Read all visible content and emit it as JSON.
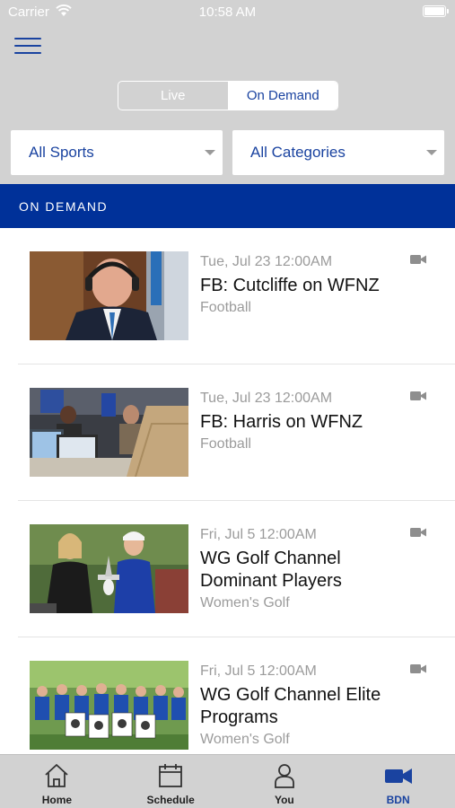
{
  "status_bar": {
    "carrier": "Carrier",
    "time": "10:58 AM"
  },
  "segmented": {
    "live_label": "Live",
    "ondemand_label": "On Demand",
    "selected": "On Demand"
  },
  "filters": {
    "sports": "All Sports",
    "categories": "All Categories"
  },
  "section": {
    "title": "ON DEMAND"
  },
  "videos": [
    {
      "date": "Tue, Jul 23 12:00AM",
      "title": "FB: Cutcliffe on WFNZ",
      "category": "Football"
    },
    {
      "date": "Tue, Jul 23 12:00AM",
      "title": "FB: Harris on WFNZ",
      "category": "Football"
    },
    {
      "date": "Fri, Jul 5 12:00AM",
      "title": "WG Golf Channel Dominant Players",
      "category": "Women's Golf"
    },
    {
      "date": "Fri, Jul 5 12:00AM",
      "title": "WG Golf Channel Elite Programs",
      "category": "Women's Golf"
    }
  ],
  "tabbar": {
    "items": [
      {
        "label": "Home",
        "icon": "house-icon"
      },
      {
        "label": "Schedule",
        "icon": "calendar-icon"
      },
      {
        "label": "You",
        "icon": "person-icon"
      },
      {
        "label": "BDN",
        "icon": "video-camera-icon"
      }
    ],
    "active": "BDN"
  },
  "colors": {
    "brand_blue": "#1a43a0",
    "header_blue": "#003199",
    "chrome_gray": "#d2d2d2"
  }
}
